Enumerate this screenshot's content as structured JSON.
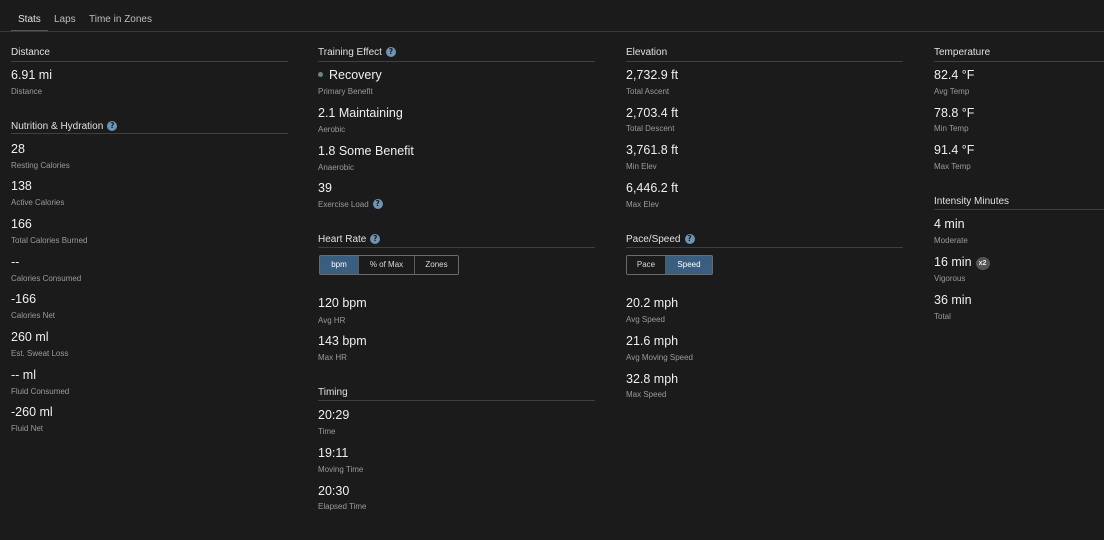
{
  "tabs": [
    "Stats",
    "Laps",
    "Time in Zones"
  ],
  "colors": {
    "accent": "#3a5e80",
    "help": "#6f93b3",
    "dot": "#6b8a7a"
  },
  "distance": {
    "title": "Distance",
    "items": [
      {
        "value": "6.91 mi",
        "label": "Distance"
      }
    ]
  },
  "nutrition": {
    "title": "Nutrition & Hydration",
    "items": [
      {
        "value": "28",
        "label": "Resting Calories"
      },
      {
        "value": "138",
        "label": "Active Calories"
      },
      {
        "value": "166",
        "label": "Total Calories Burned"
      },
      {
        "value": "--",
        "label": "Calories Consumed"
      },
      {
        "value": "-166",
        "label": "Calories Net"
      },
      {
        "value": "260 ml",
        "label": "Est. Sweat Loss"
      },
      {
        "value": "-- ml",
        "label": "Fluid Consumed"
      },
      {
        "value": "-260 ml",
        "label": "Fluid Net"
      }
    ]
  },
  "training_effect": {
    "title": "Training Effect",
    "items": [
      {
        "value": "Recovery",
        "label": "Primary Benefit"
      },
      {
        "value": "2.1 Maintaining",
        "label": "Aerobic"
      },
      {
        "value": "1.8 Some Benefit",
        "label": "Anaerobic"
      },
      {
        "value": "39",
        "label": "Exercise Load"
      }
    ]
  },
  "heart_rate": {
    "title": "Heart Rate",
    "toggle": [
      "bpm",
      "% of Max",
      "Zones"
    ],
    "selected": "bpm",
    "items": [
      {
        "value": "120 bpm",
        "label": "Avg HR"
      },
      {
        "value": "143 bpm",
        "label": "Max HR"
      }
    ]
  },
  "timing": {
    "title": "Timing",
    "items": [
      {
        "value": "20:29",
        "label": "Time"
      },
      {
        "value": "19:11",
        "label": "Moving Time"
      },
      {
        "value": "20:30",
        "label": "Elapsed Time"
      }
    ]
  },
  "elevation": {
    "title": "Elevation",
    "items": [
      {
        "value": "2,732.9 ft",
        "label": "Total Ascent"
      },
      {
        "value": "2,703.4 ft",
        "label": "Total Descent"
      },
      {
        "value": "3,761.8 ft",
        "label": "Min Elev"
      },
      {
        "value": "6,446.2 ft",
        "label": "Max Elev"
      }
    ]
  },
  "pace_speed": {
    "title": "Pace/Speed",
    "toggle": [
      "Pace",
      "Speed"
    ],
    "selected": "Speed",
    "items": [
      {
        "value": "20.2 mph",
        "label": "Avg Speed"
      },
      {
        "value": "21.6 mph",
        "label": "Avg Moving Speed"
      },
      {
        "value": "32.8 mph",
        "label": "Max Speed"
      }
    ]
  },
  "temperature": {
    "title": "Temperature",
    "items": [
      {
        "value": "82.4 °F",
        "label": "Avg Temp"
      },
      {
        "value": "78.8 °F",
        "label": "Min Temp"
      },
      {
        "value": "91.4 °F",
        "label": "Max Temp"
      }
    ]
  },
  "intensity": {
    "title": "Intensity Minutes",
    "items": [
      {
        "value": "4 min",
        "label": "Moderate"
      },
      {
        "value": "16 min",
        "label": "Vigorous",
        "badge": "x2"
      },
      {
        "value": "36 min",
        "label": "Total"
      }
    ]
  }
}
